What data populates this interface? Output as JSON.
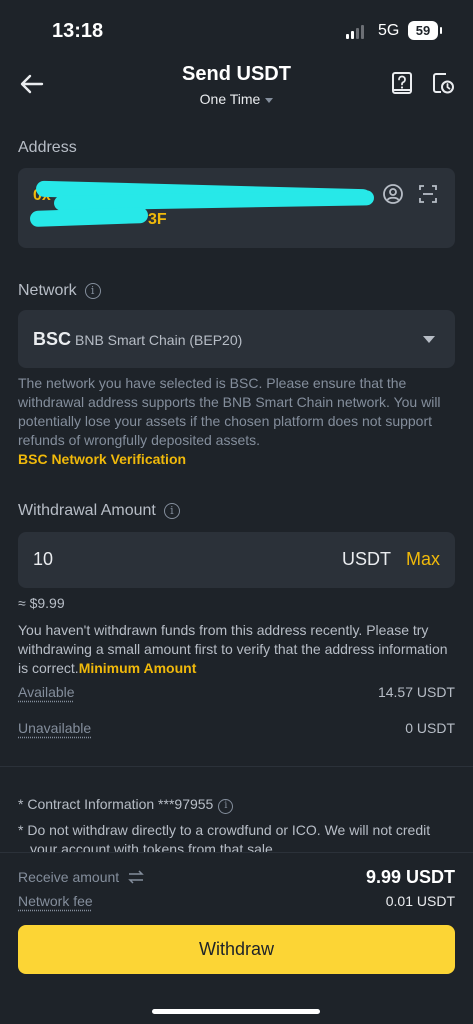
{
  "status": {
    "time": "13:18",
    "network": "5G",
    "battery": "59"
  },
  "header": {
    "title": "Send USDT",
    "subtitle": "One Time"
  },
  "address": {
    "label": "Address",
    "line1": "0x",
    "line2": "3F"
  },
  "network": {
    "label": "Network",
    "code": "BSC",
    "name": "BNB Smart Chain (BEP20)",
    "notice": "The network you have selected is BSC. Please ensure that the withdrawal address supports the BNB Smart Chain network. You will potentially lose your assets if the chosen platform does not support refunds of wrongfully deposited assets.",
    "verify_link": "BSC Network Verification"
  },
  "amount": {
    "label": "Withdrawal Amount",
    "value": "10",
    "unit": "USDT",
    "max_label": "Max",
    "approx": "≈ $9.99",
    "warning": "You haven't withdrawn funds from this address recently. Please try withdrawing a small amount first to verify that the address information is correct.",
    "minimum_link": "Minimum Amount"
  },
  "balances": [
    {
      "label": "Available",
      "value": "14.57 USDT"
    },
    {
      "label": "Unavailable",
      "value": "0 USDT"
    }
  ],
  "contract": {
    "text": "* Contract Information ***97955"
  },
  "note": "* Do not withdraw directly to a crowdfund or ICO. We will not credit your account with tokens from that sale.",
  "footer": {
    "receive_label": "Receive amount",
    "receive_value": "9.99 USDT",
    "fee_label": "Network fee",
    "fee_value": "0.01 USDT",
    "button": "Withdraw"
  },
  "colors": {
    "accent": "#f0b90b",
    "button": "#fcd535",
    "background": "#1e2329",
    "panel": "#2b3139",
    "redaction": "#27e8e8"
  }
}
